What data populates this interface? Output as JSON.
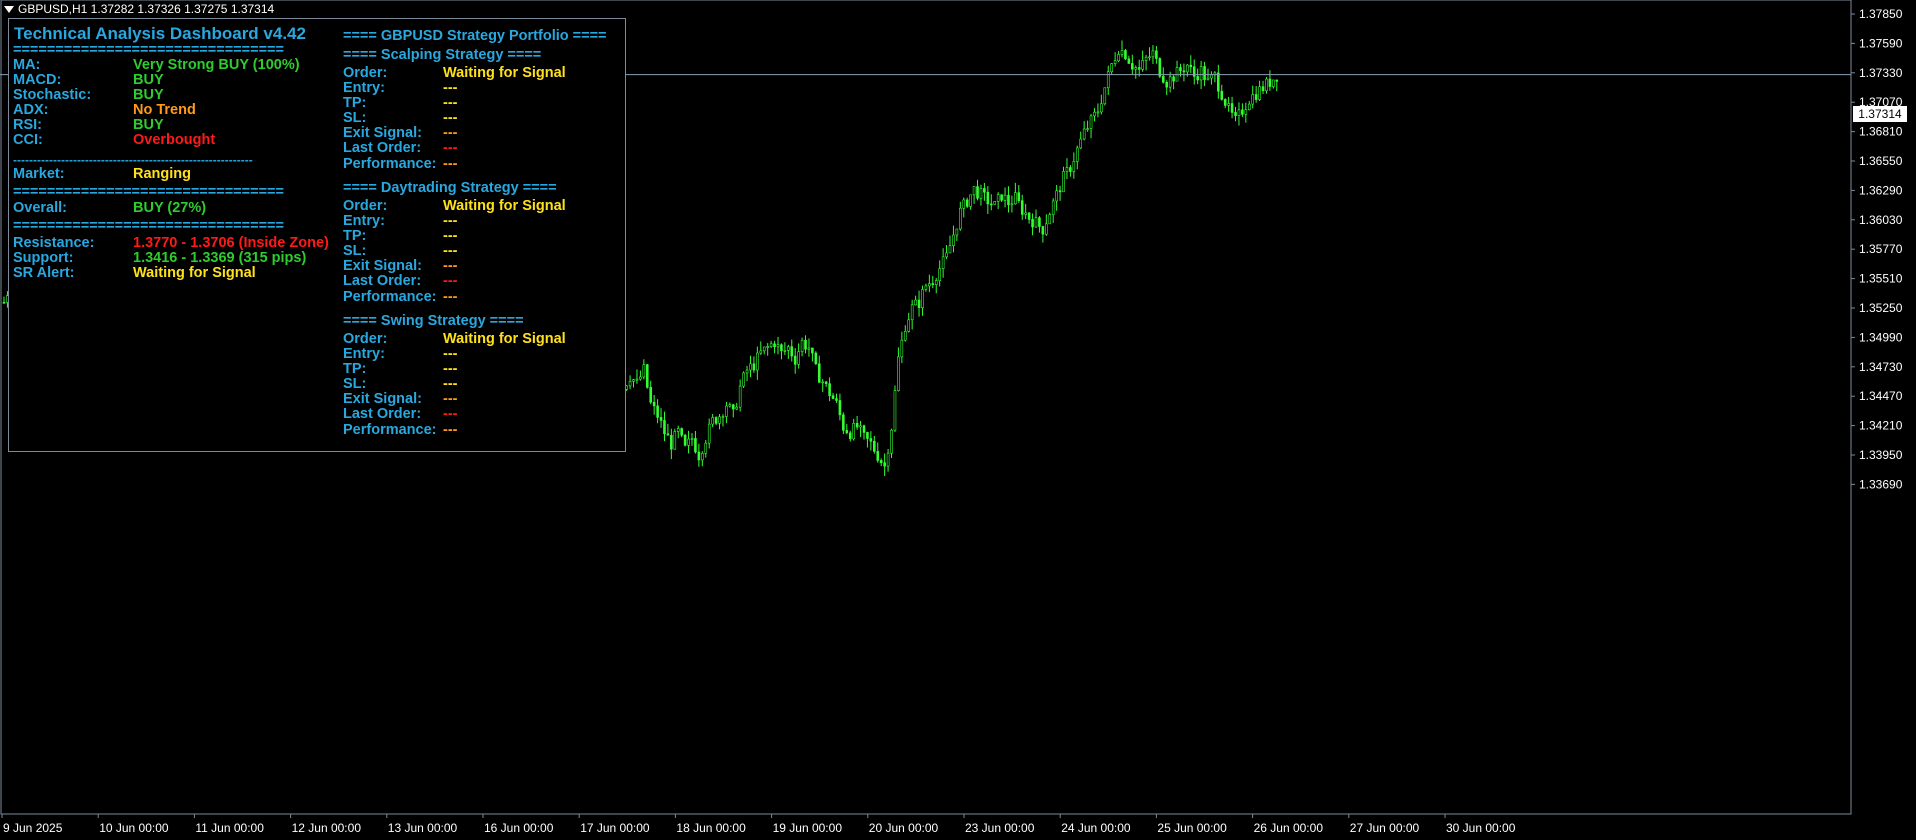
{
  "window": {
    "symbol_line": "GBPUSD,H1  1.37282 1.37326 1.37275 1.37314"
  },
  "current_price_tag": "1.37314",
  "colors": {
    "background": "#000000",
    "candle": "#32ff32",
    "cyan": "#29a8e0",
    "green": "#2ecc2e",
    "yellow": "#ffe11a",
    "orange": "#ff9a1a",
    "red": "#ff1a1a"
  },
  "dashboard": {
    "title": "Technical Analysis Dashboard v4.42",
    "separator": "================================",
    "dash_separator": "------------------------------------------------------------",
    "indicators": [
      {
        "label": "MA:",
        "value": "Very Strong BUY (100%)",
        "color": "#2ecc2e"
      },
      {
        "label": "MACD:",
        "value": "BUY",
        "color": "#2ecc2e"
      },
      {
        "label": "Stochastic:",
        "value": "BUY",
        "color": "#2ecc2e"
      },
      {
        "label": "ADX:",
        "value": "No Trend",
        "color": "#ff9a1a"
      },
      {
        "label": "RSI:",
        "value": "BUY",
        "color": "#2ecc2e"
      },
      {
        "label": "CCI:",
        "value": "Overbought",
        "color": "#ff1a1a"
      }
    ],
    "market": {
      "label": "Market:",
      "value": "Ranging"
    },
    "overall": {
      "label": "Overall:",
      "value": "BUY (27%)"
    },
    "sr": [
      {
        "label": "Resistance:",
        "value": "1.3770 - 1.3706 (Inside Zone)",
        "color": "#ff1a1a"
      },
      {
        "label": "Support:",
        "value": "1.3416 - 1.3369 (315 pips)",
        "color": "#2ecc2e"
      },
      {
        "label": "SR Alert:",
        "value": "Waiting for Signal",
        "color": "#ffe11a"
      }
    ]
  },
  "portfolio": {
    "title": "==== GBPUSD Strategy Portfolio ====",
    "strategies": [
      {
        "name": "==== Scalping Strategy ====",
        "rows": [
          {
            "label": "Order:",
            "value": "Waiting for Signal"
          },
          {
            "label": "Entry:",
            "value": "---"
          },
          {
            "label": "TP:",
            "value": "---"
          },
          {
            "label": "SL:",
            "value": "---"
          },
          {
            "label": "Exit Signal:",
            "value": "---"
          },
          {
            "label": "Last Order:",
            "value": "---"
          },
          {
            "label": "Performance:",
            "value": "---"
          }
        ]
      },
      {
        "name": "==== Daytrading Strategy ====",
        "rows": [
          {
            "label": "Order:",
            "value": "Waiting for Signal"
          },
          {
            "label": "Entry:",
            "value": "---"
          },
          {
            "label": "TP:",
            "value": "---"
          },
          {
            "label": "SL:",
            "value": "---"
          },
          {
            "label": "Exit Signal:",
            "value": "---"
          },
          {
            "label": "Last Order:",
            "value": "---"
          },
          {
            "label": "Performance:",
            "value": "---"
          }
        ]
      },
      {
        "name": "==== Swing Strategy ====",
        "rows": [
          {
            "label": "Order:",
            "value": "Waiting for Signal"
          },
          {
            "label": "Entry:",
            "value": "---"
          },
          {
            "label": "TP:",
            "value": "---"
          },
          {
            "label": "SL:",
            "value": "---"
          },
          {
            "label": "Exit Signal:",
            "value": "---"
          },
          {
            "label": "Last Order:",
            "value": "---"
          },
          {
            "label": "Performance:",
            "value": "---"
          }
        ]
      }
    ]
  },
  "chart_data": {
    "type": "candlestick",
    "symbol": "GBPUSD",
    "timeframe": "H1",
    "y_ticks": [
      "1.37850",
      "1.37590",
      "1.37330",
      "1.37070",
      "1.36810",
      "1.36550",
      "1.36290",
      "1.36030",
      "1.35770",
      "1.35510",
      "1.35250",
      "1.34990",
      "1.34730",
      "1.34470",
      "1.34210",
      "1.33950",
      "1.33690"
    ],
    "ylim": [
      1.3361,
      1.3788
    ],
    "x_ticks": [
      "9 Jun 2025",
      "10 Jun 00:00",
      "11 Jun 00:00",
      "12 Jun 00:00",
      "13 Jun 00:00",
      "16 Jun 00:00",
      "17 Jun 00:00",
      "18 Jun 00:00",
      "19 Jun 00:00",
      "20 Jun 00:00",
      "23 Jun 00:00",
      "24 Jun 00:00",
      "25 Jun 00:00",
      "26 Jun 00:00",
      "27 Jun 00:00",
      "30 Jun 00:00"
    ],
    "close_path": [
      [
        0,
        1.353
      ],
      [
        8,
        1.3548
      ],
      [
        16,
        1.3555
      ],
      [
        24,
        1.354
      ],
      [
        32,
        1.3545
      ],
      [
        40,
        1.3535
      ],
      [
        48,
        1.3552
      ],
      [
        56,
        1.3546
      ],
      [
        64,
        1.354
      ],
      [
        72,
        1.353
      ],
      [
        80,
        1.354
      ],
      [
        88,
        1.3525
      ],
      [
        96,
        1.3535
      ],
      [
        104,
        1.3515
      ],
      [
        112,
        1.349
      ],
      [
        120,
        1.348
      ],
      [
        128,
        1.35
      ],
      [
        136,
        1.351
      ],
      [
        144,
        1.3495
      ],
      [
        152,
        1.3505
      ],
      [
        160,
        1.35
      ],
      [
        168,
        1.349
      ],
      [
        176,
        1.3495
      ],
      [
        184,
        1.35
      ],
      [
        192,
        1.3505
      ],
      [
        200,
        1.351
      ],
      [
        208,
        1.352
      ],
      [
        216,
        1.3535
      ],
      [
        224,
        1.3548
      ],
      [
        232,
        1.3555
      ],
      [
        240,
        1.3545
      ],
      [
        248,
        1.356
      ],
      [
        256,
        1.3558
      ],
      [
        264,
        1.355
      ],
      [
        272,
        1.3555
      ],
      [
        280,
        1.3545
      ],
      [
        288,
        1.355
      ],
      [
        296,
        1.356
      ],
      [
        304,
        1.3555
      ],
      [
        312,
        1.3548
      ],
      [
        320,
        1.3545
      ],
      [
        328,
        1.354
      ],
      [
        336,
        1.3548
      ],
      [
        344,
        1.3545
      ],
      [
        352,
        1.355
      ],
      [
        360,
        1.3555
      ],
      [
        368,
        1.354
      ],
      [
        376,
        1.355
      ],
      [
        384,
        1.3545
      ],
      [
        392,
        1.355
      ],
      [
        400,
        1.3548
      ],
      [
        408,
        1.3552
      ],
      [
        416,
        1.3545
      ],
      [
        424,
        1.355
      ],
      [
        432,
        1.3548
      ],
      [
        440,
        1.3545
      ],
      [
        448,
        1.355
      ],
      [
        456,
        1.354
      ],
      [
        464,
        1.3545
      ],
      [
        472,
        1.355
      ],
      [
        480,
        1.3548
      ],
      [
        488,
        1.3552
      ],
      [
        496,
        1.355
      ],
      [
        504,
        1.3548
      ],
      [
        512,
        1.3545
      ],
      [
        520,
        1.3548
      ],
      [
        528,
        1.3552
      ],
      [
        536,
        1.355
      ],
      [
        544,
        1.3545
      ],
      [
        552,
        1.354
      ],
      [
        560,
        1.355
      ],
      [
        568,
        1.3545
      ],
      [
        576,
        1.3548
      ],
      [
        584,
        1.3552
      ],
      [
        592,
        1.355
      ],
      [
        600,
        1.3548
      ],
      [
        608,
        1.355
      ],
      [
        616,
        1.3545
      ],
      [
        624,
        1.355
      ],
      [
        632,
        1.3555
      ],
      [
        640,
        1.356
      ],
      [
        648,
        1.352
      ],
      [
        652,
        1.349
      ],
      [
        656,
        1.346
      ],
      [
        660,
        1.344
      ],
      [
        664,
        1.343
      ],
      [
        672,
        1.3425
      ],
      [
        680,
        1.343
      ],
      [
        688,
        1.344
      ],
      [
        696,
        1.3445
      ],
      [
        704,
        1.345
      ],
      [
        712,
        1.346
      ],
      [
        720,
        1.3455
      ],
      [
        728,
        1.3465
      ],
      [
        736,
        1.3458
      ],
      [
        744,
        1.347
      ],
      [
        752,
        1.344
      ],
      [
        760,
        1.343
      ],
      [
        768,
        1.3415
      ],
      [
        776,
        1.3405
      ],
      [
        784,
        1.3415
      ],
      [
        792,
        1.34
      ],
      [
        800,
        1.341
      ],
      [
        808,
        1.3395
      ],
      [
        816,
        1.341
      ],
      [
        824,
        1.3425
      ],
      [
        832,
        1.343
      ],
      [
        840,
        1.344
      ],
      [
        848,
        1.343
      ],
      [
        856,
        1.3455
      ],
      [
        864,
        1.347
      ],
      [
        872,
        1.3475
      ],
      [
        880,
        1.3485
      ],
      [
        888,
        1.349
      ],
      [
        896,
        1.3495
      ],
      [
        904,
        1.3485
      ],
      [
        912,
        1.349
      ],
      [
        920,
        1.348
      ],
      [
        928,
        1.3495
      ],
      [
        936,
        1.349
      ],
      [
        944,
        1.347
      ],
      [
        952,
        1.346
      ],
      [
        960,
        1.345
      ],
      [
        968,
        1.344
      ],
      [
        976,
        1.342
      ],
      [
        984,
        1.3415
      ],
      [
        992,
        1.342
      ],
      [
        1000,
        1.341
      ],
      [
        1008,
        1.3405
      ],
      [
        1016,
        1.3395
      ],
      [
        1024,
        1.3385
      ],
      [
        1032,
        1.342
      ],
      [
        1040,
        1.348
      ],
      [
        1048,
        1.351
      ],
      [
        1056,
        1.3525
      ],
      [
        1064,
        1.353
      ],
      [
        1072,
        1.3545
      ],
      [
        1080,
        1.355
      ],
      [
        1088,
        1.356
      ],
      [
        1096,
        1.357
      ],
      [
        1104,
        1.359
      ],
      [
        1112,
        1.361
      ],
      [
        1120,
        1.362
      ],
      [
        1128,
        1.363
      ],
      [
        1136,
        1.3625
      ],
      [
        1144,
        1.362
      ],
      [
        1152,
        1.3615
      ],
      [
        1160,
        1.3625
      ],
      [
        1168,
        1.3618
      ],
      [
        1176,
        1.3622
      ],
      [
        1184,
        1.3612
      ],
      [
        1192,
        1.3605
      ],
      [
        1200,
        1.36
      ],
      [
        1208,
        1.3595
      ],
      [
        1216,
        1.361
      ],
      [
        1224,
        1.3625
      ],
      [
        1232,
        1.364
      ],
      [
        1240,
        1.365
      ],
      [
        1248,
        1.3665
      ],
      [
        1256,
        1.368
      ],
      [
        1264,
        1.369
      ],
      [
        1272,
        1.37
      ],
      [
        1280,
        1.372
      ],
      [
        1288,
        1.374
      ],
      [
        1296,
        1.3755
      ],
      [
        1304,
        1.375
      ],
      [
        1312,
        1.374
      ],
      [
        1320,
        1.3735
      ],
      [
        1328,
        1.3745
      ],
      [
        1336,
        1.375
      ],
      [
        1344,
        1.3735
      ],
      [
        1352,
        1.3725
      ],
      [
        1360,
        1.373
      ],
      [
        1368,
        1.3735
      ],
      [
        1376,
        1.374
      ],
      [
        1384,
        1.373
      ],
      [
        1392,
        1.3735
      ],
      [
        1400,
        1.3725
      ],
      [
        1408,
        1.373
      ],
      [
        1416,
        1.3715
      ],
      [
        1424,
        1.37
      ],
      [
        1432,
        1.369
      ],
      [
        1440,
        1.37
      ],
      [
        1448,
        1.371
      ],
      [
        1456,
        1.3715
      ],
      [
        1464,
        1.372
      ],
      [
        1472,
        1.3725
      ],
      [
        1480,
        1.3731
      ]
    ],
    "current_price": 1.37314
  }
}
